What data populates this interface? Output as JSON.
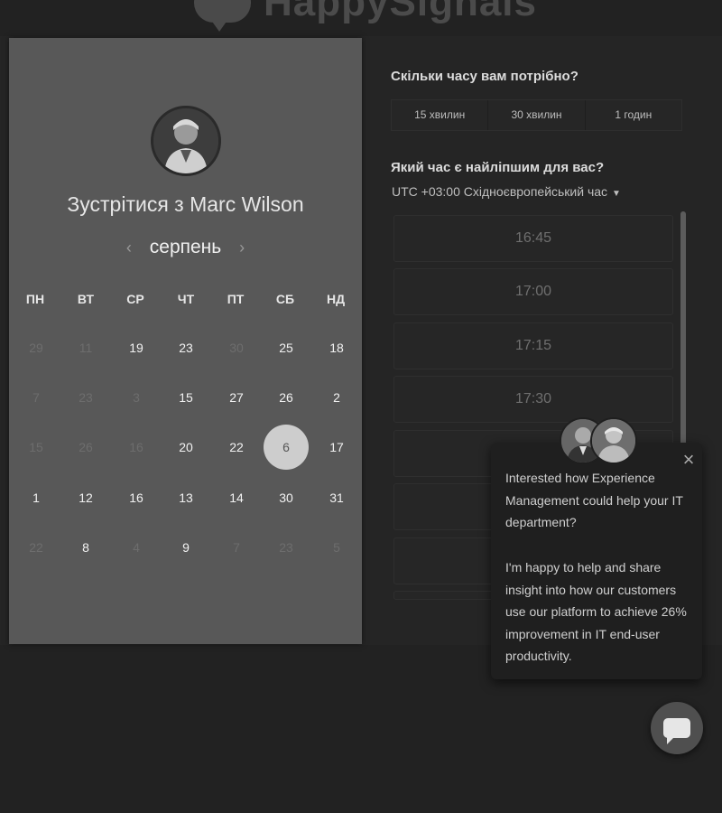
{
  "brand": {
    "logo_text": "HappySignals"
  },
  "scheduler": {
    "host_title": "Зустрітися з Marc Wilson",
    "month_label": "серпень",
    "weekdays": [
      "ПН",
      "ВТ",
      "СР",
      "ЧТ",
      "ПТ",
      "СБ",
      "НД"
    ],
    "weeks": [
      [
        {
          "d": "29",
          "m": true
        },
        {
          "d": "11",
          "m": true
        },
        {
          "d": "19",
          "m": false
        },
        {
          "d": "23",
          "m": false
        },
        {
          "d": "30",
          "m": true
        },
        {
          "d": "25",
          "m": false
        },
        {
          "d": "18",
          "m": false
        }
      ],
      [
        {
          "d": "7",
          "m": true
        },
        {
          "d": "23",
          "m": true
        },
        {
          "d": "3",
          "m": true
        },
        {
          "d": "15",
          "m": false
        },
        {
          "d": "27",
          "m": false
        },
        {
          "d": "26",
          "m": false
        },
        {
          "d": "2",
          "m": false
        }
      ],
      [
        {
          "d": "15",
          "m": true
        },
        {
          "d": "26",
          "m": true
        },
        {
          "d": "16",
          "m": true
        },
        {
          "d": "20",
          "m": false
        },
        {
          "d": "22",
          "m": false
        },
        {
          "d": "6",
          "m": false,
          "sel": true
        },
        {
          "d": "17",
          "m": false
        }
      ],
      [
        {
          "d": "1",
          "m": false
        },
        {
          "d": "12",
          "m": false
        },
        {
          "d": "16",
          "m": false
        },
        {
          "d": "13",
          "m": false
        },
        {
          "d": "14",
          "m": false
        },
        {
          "d": "30",
          "m": false
        },
        {
          "d": "31",
          "m": false
        }
      ],
      [
        {
          "d": "22",
          "m": true
        },
        {
          "d": "8",
          "m": false
        },
        {
          "d": "4",
          "m": true
        },
        {
          "d": "9",
          "m": false
        },
        {
          "d": "7",
          "m": true
        },
        {
          "d": "23",
          "m": true
        },
        {
          "d": "5",
          "m": true
        }
      ]
    ]
  },
  "duration": {
    "question": "Скільки часу вам потрібно?",
    "options": [
      "15 хвилин",
      "30 хвилин",
      "1 годин"
    ]
  },
  "time": {
    "question": "Який час є найліпшим для вас?",
    "timezone": "UTC +03:00 Східноєвропейський час",
    "slots": [
      "16:45",
      "17:00",
      "17:15",
      "17:30",
      "",
      "",
      "",
      ""
    ]
  },
  "popup": {
    "message_1": "Interested how Experience Management could help your IT department?",
    "message_2": "I'm happy to help and share insight into how our customers use our platform to achieve 26% improvement in IT end-user productivity."
  },
  "icons": {
    "close": "close-icon",
    "chat": "chat-bubble-icon",
    "prev": "chevron-left-icon",
    "next": "chevron-right-icon",
    "tz_caret": "caret-down-icon"
  }
}
